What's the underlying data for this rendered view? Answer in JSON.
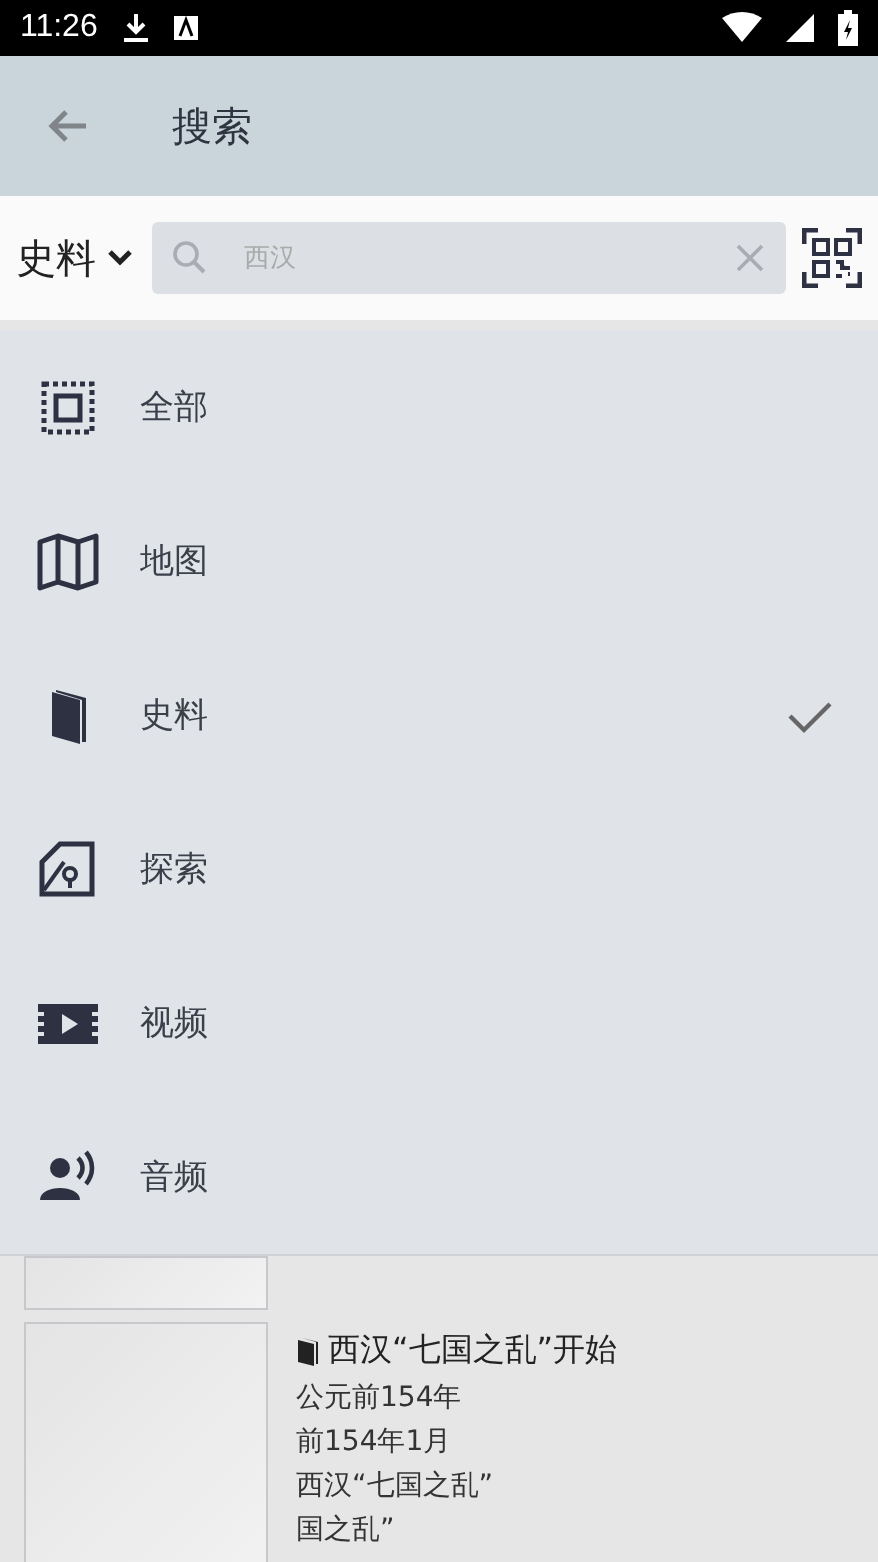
{
  "status_bar": {
    "time": "11:26"
  },
  "app_bar": {
    "title": "搜索"
  },
  "search": {
    "category": "史料",
    "value": "西汉"
  },
  "results": [
    {
      "title": "西汉“七国之乱”开始",
      "date": "公元前154年",
      "lines": [
        "前154年1月",
        "西汉“七国之乱”",
        "国之乱”"
      ]
    }
  ],
  "menu": {
    "items": [
      {
        "kind": "all",
        "label": "全部",
        "selected": false
      },
      {
        "kind": "map",
        "label": "地图",
        "selected": false
      },
      {
        "kind": "book",
        "label": "史料",
        "selected": true
      },
      {
        "kind": "explore",
        "label": "探索",
        "selected": false
      },
      {
        "kind": "video",
        "label": "视频",
        "selected": false
      },
      {
        "kind": "audio",
        "label": "音频",
        "selected": false
      }
    ]
  }
}
